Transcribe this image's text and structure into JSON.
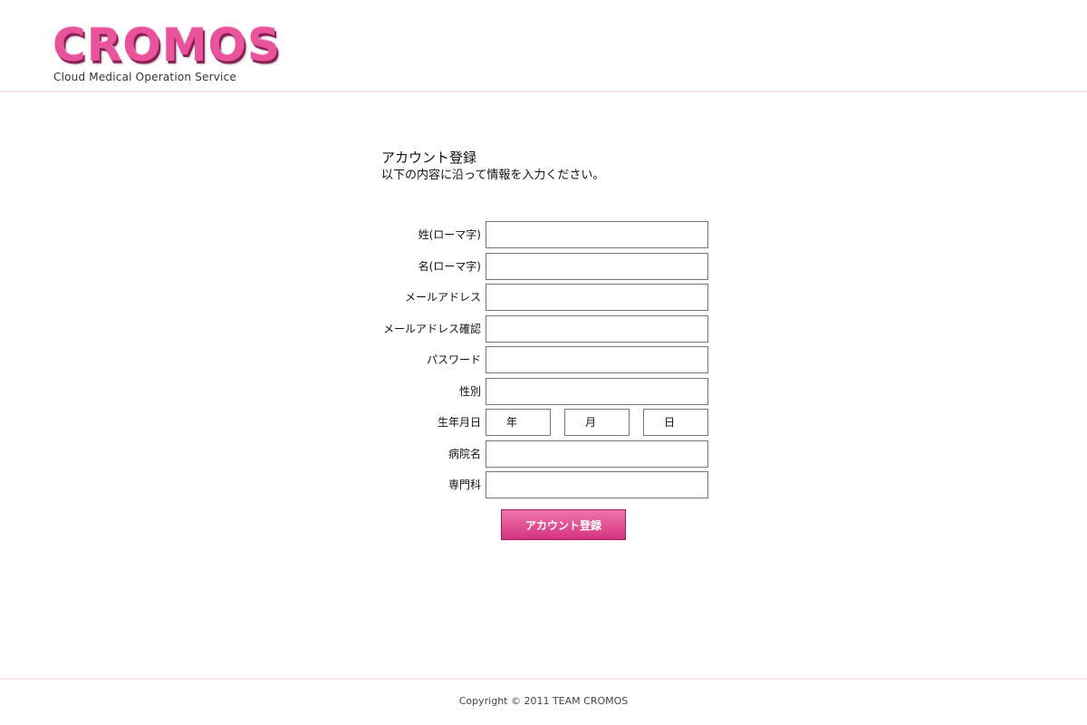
{
  "header": {
    "logo_text": "CROMOS",
    "logo_subtitle": "Cloud Medical Operation Service"
  },
  "intro": {
    "title": "アカウント登録",
    "description": "以下の内容に沿って情報を入力ください。"
  },
  "form": {
    "fields": [
      {
        "label": "姓(ローマ字)",
        "value": ""
      },
      {
        "label": "名(ローマ字)",
        "value": ""
      },
      {
        "label": "メールアドレス",
        "value": ""
      },
      {
        "label": "メールアドレス確認",
        "value": ""
      },
      {
        "label": "パスワード",
        "value": ""
      },
      {
        "label": "性別",
        "value": ""
      },
      {
        "label": "生年月日"
      },
      {
        "label": "病院名",
        "value": ""
      },
      {
        "label": "専門科",
        "value": ""
      }
    ],
    "birthdate": {
      "year": "年",
      "month": "月",
      "day": "日"
    },
    "submit_label": "アカウント登録"
  },
  "footer": {
    "copyright": "Copyright © 2011 TEAM CROMOS"
  },
  "colors": {
    "brand_pink": "#e9539c",
    "button_top": "#f074ac",
    "button_bottom": "#d3347f",
    "divider": "#fbe3ee"
  }
}
